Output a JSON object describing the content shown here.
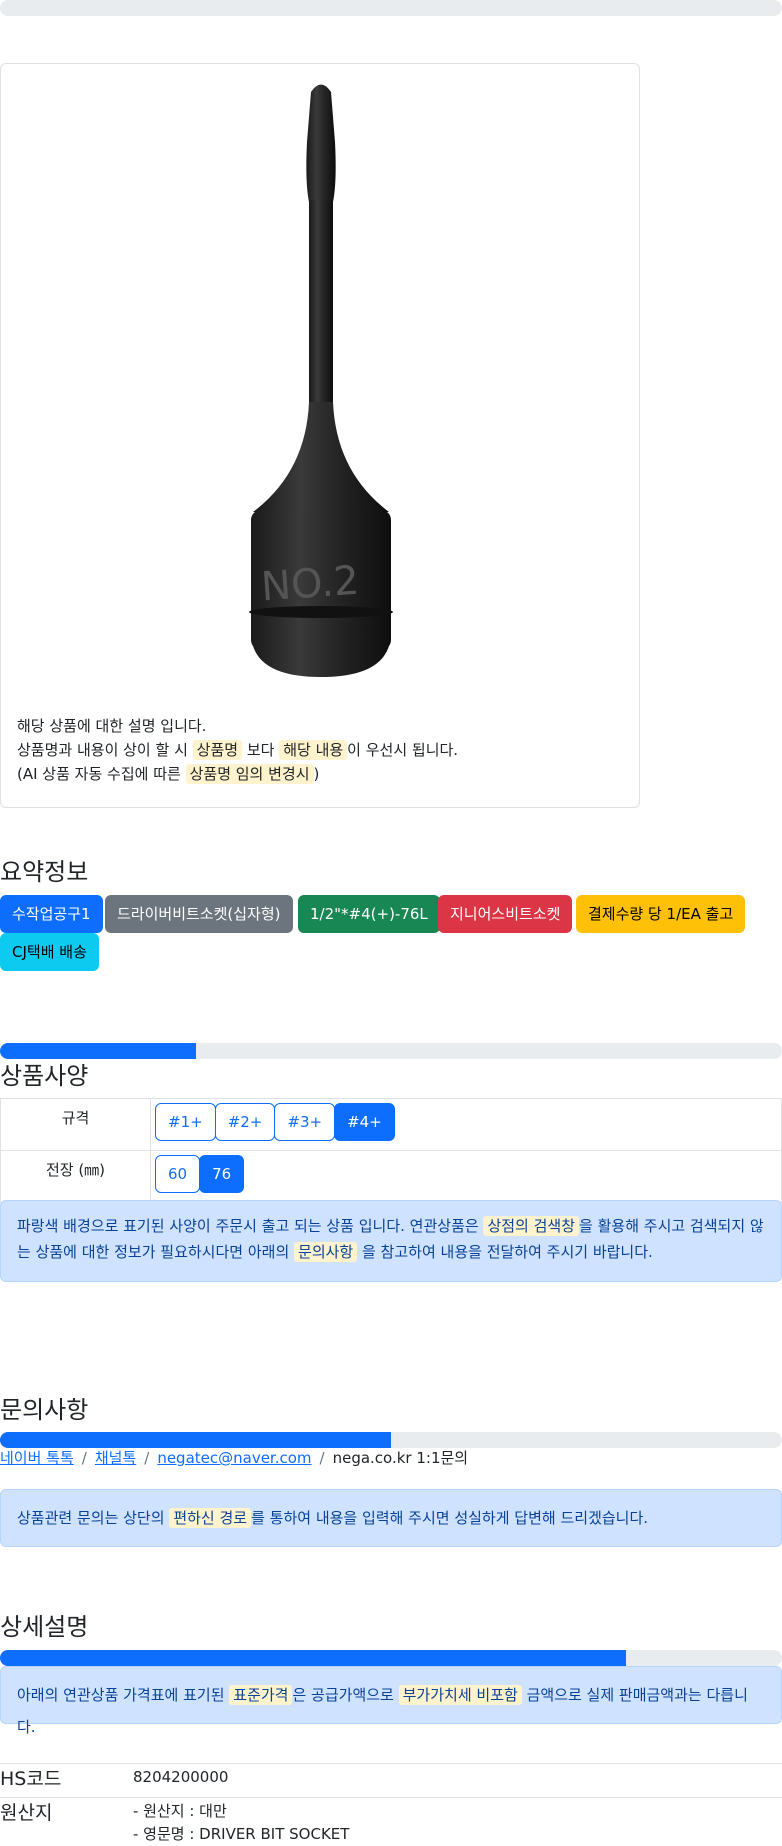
{
  "progress": {
    "top_fill_percent": 0,
    "spec_fill_percent": 25,
    "contact_fill_percent": 50,
    "detail_fill_percent": 80
  },
  "product": {
    "image_label": "NO.2",
    "desc_line1": "해당 상품에 대한 설명 입니다.",
    "desc_line2_a": "상품명과 내용이 상이 할 시 ",
    "desc_line2_hl1": "상품명",
    "desc_line2_b": " 보다 ",
    "desc_line2_hl2": "해당 내용",
    "desc_line2_c": "이 우선시 됩니다.",
    "desc_line3_a": "(AI 상품 자동 수집에 따른 ",
    "desc_line3_hl": "상품명 임의 변경시",
    "desc_line3_b": ")"
  },
  "summary": {
    "title": "요약정보",
    "badges": [
      "수작업공구1",
      "드라이버비트소켓(십자형)",
      "1/2\"*#4(+)-76L",
      "지니어스비트소켓",
      "결제수량 당 1/EA 출고",
      "CJ택배 배송"
    ],
    "badge_colors": [
      "#0d6efd",
      "#6c757d",
      "#198754",
      "#dc3545",
      "#ffc107",
      "#0dcaf0"
    ]
  },
  "spec": {
    "title": "상품사양",
    "rows": [
      {
        "label": "규격",
        "options": [
          "#1+",
          "#2+",
          "#3+",
          "#4+"
        ],
        "active": "#4+"
      },
      {
        "label": "전장 (㎜)",
        "options": [
          "60",
          "76"
        ],
        "active": "76"
      }
    ],
    "notice_a": "파랑색 배경으로 표기된 사양이 주문시 출고 되는 상품 입니다. 연관상품은 ",
    "notice_hl1": "상점의 검색창",
    "notice_b": "을 활용해 주시고 검색되지 않는 상품에 대한 정보가 필요하시다면 아래의 ",
    "notice_hl2": "문의사항",
    "notice_c": " 을 참고하여 내용을 전달하여 주시기 바랍니다."
  },
  "contact": {
    "title": "문의사항",
    "links": [
      "네이버 톡톡",
      "채널톡",
      "negatec@naver.com"
    ],
    "plain": "nega.co.kr 1:1문의",
    "notice_a": "상품관련 문의는 상단의 ",
    "notice_hl": "편하신 경로",
    "notice_b": "를 통하여 내용을 입력해 주시면 성실하게 답변해 드리겠습니다."
  },
  "detail": {
    "title": "상세설명",
    "notice_a": "아래의 연관상품 가격표에 표기된 ",
    "notice_hl1": "표준가격",
    "notice_b": "은 공급가액으로 ",
    "notice_hl2": "부가가치세 비포함",
    "notice_c": " 금액으로 실제 판매금액과는 다릅니다.",
    "hs_label": "HS코드",
    "hs_value": "8204200000",
    "origin_label": "원산지",
    "origin_line1": "- 원산지 : 대만",
    "origin_line2": "- 영문명 : DRIVER BIT SOCKET"
  }
}
